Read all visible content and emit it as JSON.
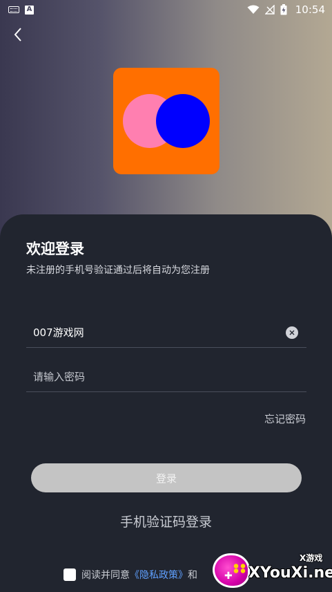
{
  "status_bar": {
    "time": "10:54",
    "left_icons": [
      "keyboard-icon",
      "accessibility-a-icon"
    ],
    "right_icons": [
      "wifi-icon",
      "no-signal-icon",
      "battery-charging-icon"
    ],
    "a_icon_text": "A"
  },
  "header": {
    "back_icon": "chevron-left-icon"
  },
  "logo": {
    "colors": {
      "background": "#ff6f00",
      "left_circle": "#ff7fb0",
      "right_circle": "#0000ff"
    }
  },
  "login": {
    "title": "欢迎登录",
    "subtitle": "未注册的手机号验证通过后将自动为您注册",
    "phone_value": "007游戏网",
    "password_placeholder": "请输入密码",
    "forgot_password": "忘记密码",
    "login_button": "登录",
    "sms_login": "手机验证码登录",
    "agreement_prefix": "阅读并同意",
    "privacy_policy": "《隐私政策》",
    "agreement_and": "和"
  },
  "watermark": {
    "top_text": "X游戏",
    "main_text": "XYouXi.net"
  },
  "colors": {
    "card_background": "#21252f",
    "button_disabled": "#c4c4c4",
    "link_blue": "#5fa0ff"
  }
}
